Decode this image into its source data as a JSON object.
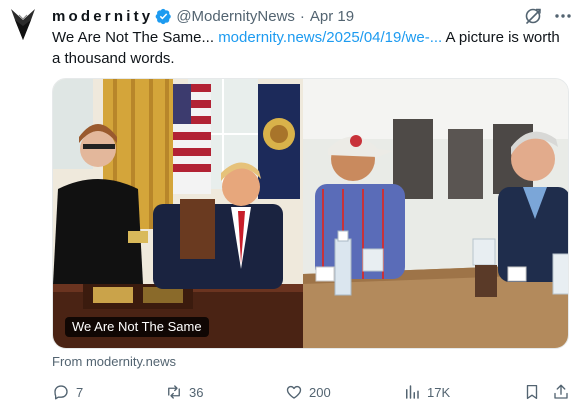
{
  "tweet": {
    "display_name": "modernity",
    "handle": "@ModernityNews",
    "separator": "·",
    "time": "Apr 19",
    "text_start": "We Are Not The Same... ",
    "link_text": "modernity.news/2025/04/19/we-...",
    "text_end": " A picture is worth a thousand words.",
    "media_caption": "We Are Not The Same",
    "source": "From modernity.news"
  },
  "actions": {
    "replies": "7",
    "reposts": "36",
    "likes": "200",
    "views": "17K"
  },
  "colors": {
    "link": "#1d9bf0",
    "verified": "#1d9bf0",
    "secondary_text": "#536471"
  },
  "icons": [
    "avatar-logo",
    "verified-badge-icon",
    "grok-icon",
    "more-icon",
    "reply-icon",
    "repost-icon",
    "like-icon",
    "views-icon",
    "bookmark-icon",
    "share-icon"
  ]
}
